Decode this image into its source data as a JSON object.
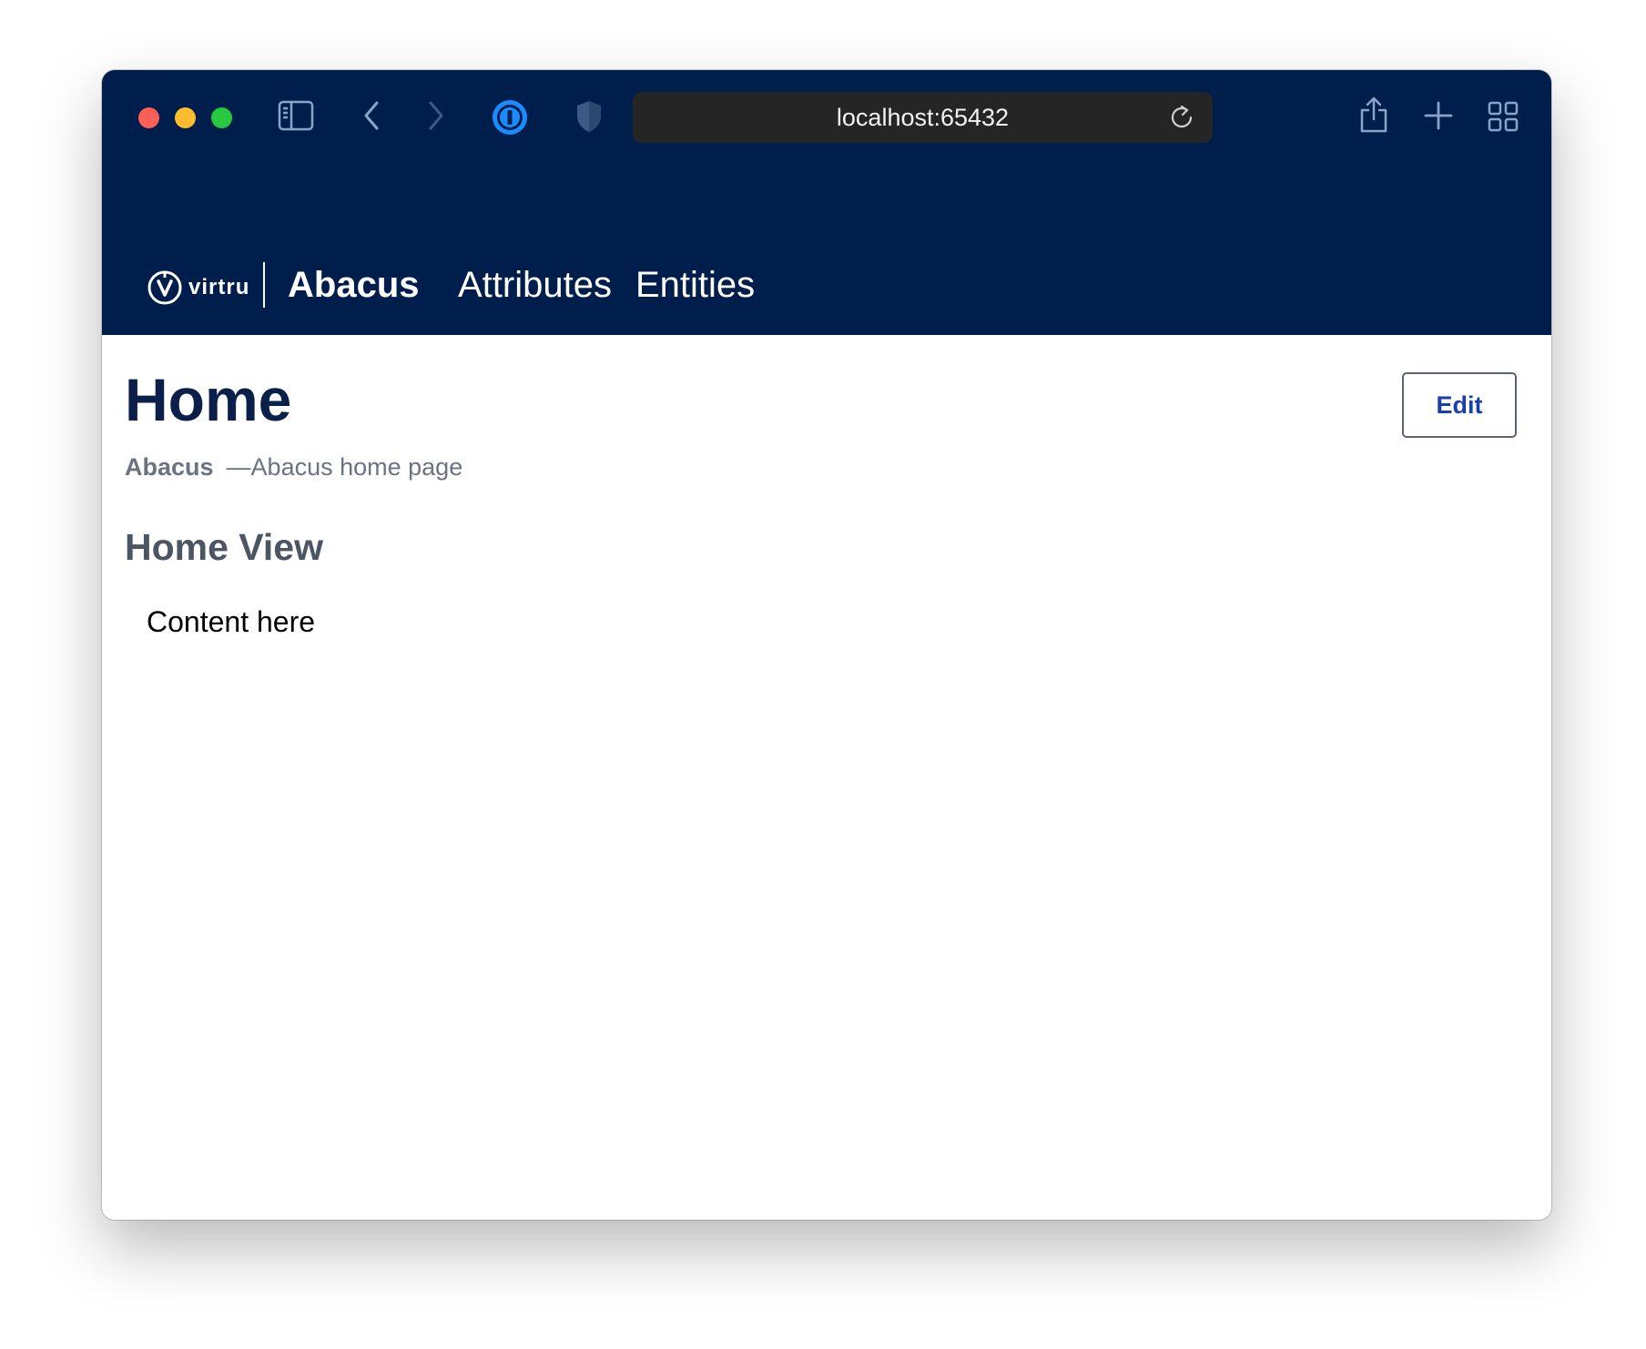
{
  "browser": {
    "url": "localhost:65432",
    "icons": {
      "sidebar": "sidebar-icon",
      "back": "chevron-left-icon",
      "forward": "chevron-right-icon",
      "password_manager": "1password-icon",
      "privacy": "shield-icon",
      "reload": "reload-icon",
      "share": "share-icon",
      "new_tab": "plus-icon",
      "tab_overview": "grid-icon"
    }
  },
  "navbar": {
    "brand_text": "virtru",
    "app_title": "Abacus",
    "items": [
      {
        "label": "Attributes"
      },
      {
        "label": "Entities"
      }
    ]
  },
  "page": {
    "title": "Home",
    "edit_label": "Edit",
    "subtitle_app": "Abacus",
    "subtitle_desc": "—Abacus home page",
    "section_title": "Home View",
    "content_text": "Content here"
  },
  "colors": {
    "header_bg": "#001e4b",
    "title": "#0a1f4a",
    "edit_text": "#1a3fa8",
    "muted": "#6b7280"
  }
}
